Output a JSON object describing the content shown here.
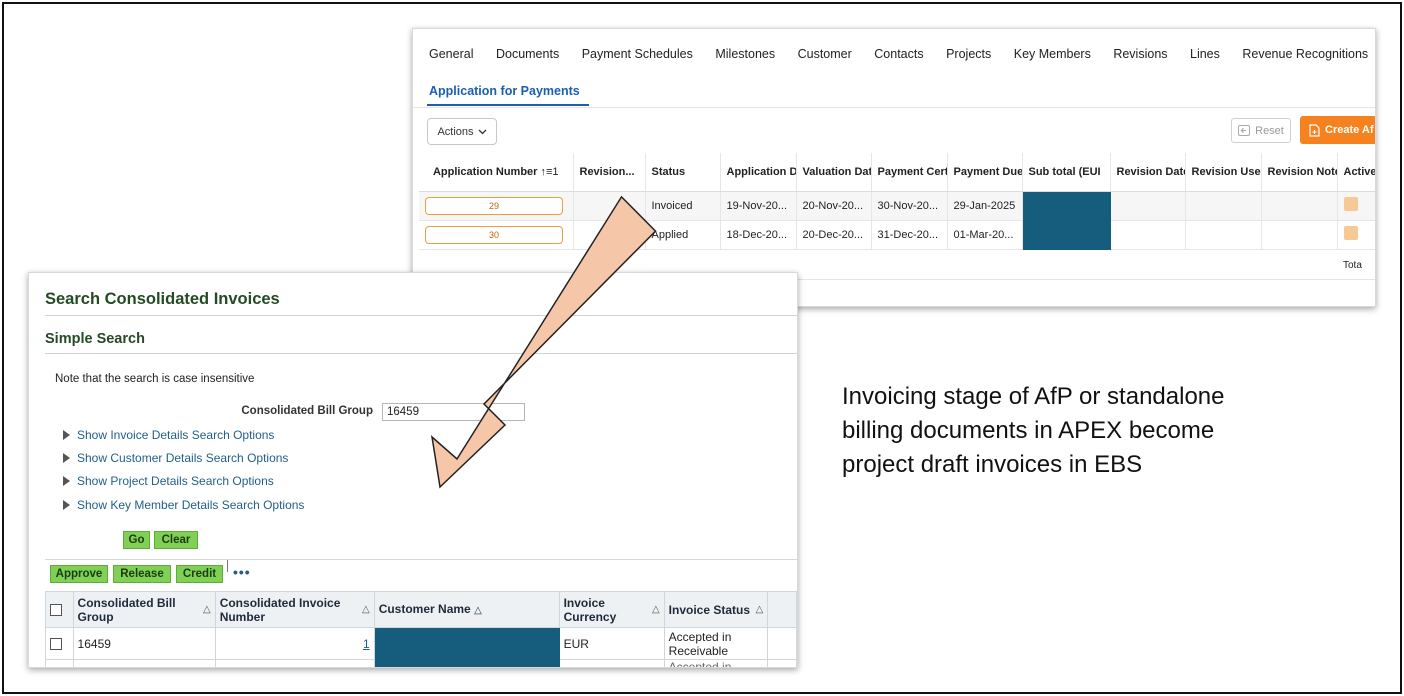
{
  "apex": {
    "tabs": [
      "General",
      "Documents",
      "Payment Schedules",
      "Milestones",
      "Customer",
      "Contacts",
      "Projects",
      "Key Members",
      "Revisions",
      "Lines",
      "Revenue Recognitions"
    ],
    "subtab": "Application for Payments",
    "actions_label": "Actions",
    "reset_label": "Reset",
    "create_label": "Create Af",
    "columns": [
      "Application Number",
      "Revision...",
      "Status",
      "Application D",
      "Valuation Dat",
      "Payment Cert",
      "Payment Due",
      "Sub total (EUI",
      "Revision Date",
      "Revision User",
      "Revision Note",
      "Active"
    ],
    "sort_indicator": "↑≡1",
    "rows": [
      {
        "app_number": "29",
        "revision": "",
        "status": "Invoiced",
        "app_date": "19-Nov-20...",
        "valuation_date": "20-Nov-20...",
        "payment_cert": "30-Nov-20...",
        "payment_due": "29-Jan-2025"
      },
      {
        "app_number": "30",
        "revision": "",
        "status": "Applied",
        "app_date": "18-Dec-20...",
        "valuation_date": "20-Dec-20...",
        "payment_cert": "31-Dec-20...",
        "payment_due": "01-Mar-20..."
      }
    ],
    "total_label": "Tota"
  },
  "ebs": {
    "title": "Search Consolidated Invoices",
    "subtitle": "Simple Search",
    "note": "Note that the search is case insensitive",
    "cbg_label": "Consolidated Bill Group",
    "cbg_value": "16459",
    "show_links": [
      "Show Invoice Details Search Options",
      "Show Customer Details Search Options",
      "Show Project Details Search Options",
      "Show Key Member Details Search Options"
    ],
    "go_label": "Go",
    "clear_label": "Clear",
    "approve_label": "Approve",
    "release_label": "Release",
    "credit_label": "Credit",
    "more_label": "•••",
    "columns": [
      "Consolidated Bill Group",
      "Consolidated Invoice Number",
      "Customer Name",
      "Invoice Currency",
      "Invoice Status"
    ],
    "sort_glyph": "△",
    "row": {
      "bill_group": "16459",
      "invoice_number": "1",
      "currency": "EUR",
      "status": "Accepted in Receivable",
      "next_status": "Accepted in"
    }
  },
  "description": "Invoicing stage of AfP or standalone billing documents in APEX become project draft invoices in EBS",
  "colors": {
    "arrow_fill": "#f5c6a8",
    "redact": "#165c7d",
    "apex_accent": "#1a5fb4",
    "create_button": "#f5821f",
    "ebs_button": "#7fd055",
    "ebs_title": "#254a26"
  }
}
